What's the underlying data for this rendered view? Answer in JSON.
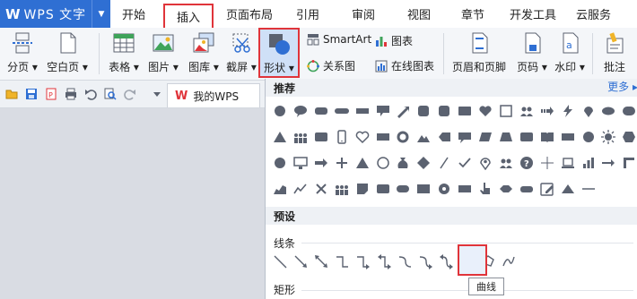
{
  "app": {
    "logo": "W",
    "title": "WPS 文字"
  },
  "menu_tabs": [
    {
      "label": "开始"
    },
    {
      "label": "插入"
    },
    {
      "label": "页面布局"
    },
    {
      "label": "引用"
    },
    {
      "label": "审阅"
    },
    {
      "label": "视图"
    },
    {
      "label": "章节"
    },
    {
      "label": "开发工具"
    },
    {
      "label": "云服务"
    }
  ],
  "ribbon": {
    "page_break": "分页",
    "blank_page": "空白页",
    "table": "表格",
    "picture": "图片",
    "gallery": "图库",
    "screenshot": "截屏",
    "shape": "形状",
    "smartart": "SmartArt",
    "chart": "图表",
    "relation_diagram": "关系图",
    "online_chart": "在线图表",
    "header_footer": "页眉和页脚",
    "page_number": "页码",
    "watermark": "水印",
    "comment": "批注"
  },
  "doc_tab": {
    "logo": "W",
    "name": "我的WPS"
  },
  "shape_gallery": {
    "recommended_header": "推荐",
    "more_link": "更多",
    "presets_header": "预设",
    "lines_label": "线条",
    "rect_label": "矩形",
    "tooltip": "曲线"
  },
  "colors": {
    "accent": "#2f6fd3",
    "highlight_border": "#e0343a",
    "icon_gray": "#5b6270"
  }
}
